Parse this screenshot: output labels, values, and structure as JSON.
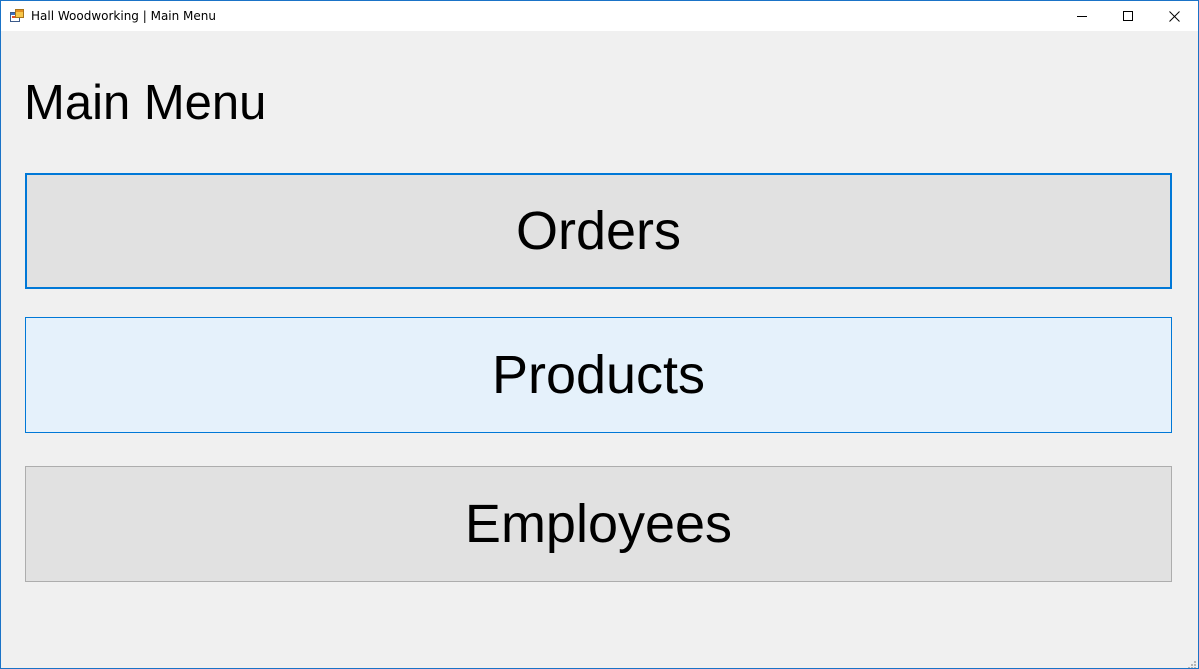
{
  "window": {
    "title": "Hall Woodworking | Main Menu",
    "icon": "app-form-icon",
    "controls": {
      "minimize_icon": "minimize-icon",
      "maximize_icon": "maximize-icon",
      "close_icon": "close-icon"
    }
  },
  "main": {
    "heading": "Main Menu",
    "buttons": [
      {
        "label": "Orders",
        "state": "focused"
      },
      {
        "label": "Products",
        "state": "hover"
      },
      {
        "label": "Employees",
        "state": "normal"
      }
    ]
  },
  "colors": {
    "accent": "#0078d7",
    "window_bg": "#f0f0f0",
    "button_bg": "#e1e1e1",
    "button_hover_bg": "#e5f1fb"
  }
}
